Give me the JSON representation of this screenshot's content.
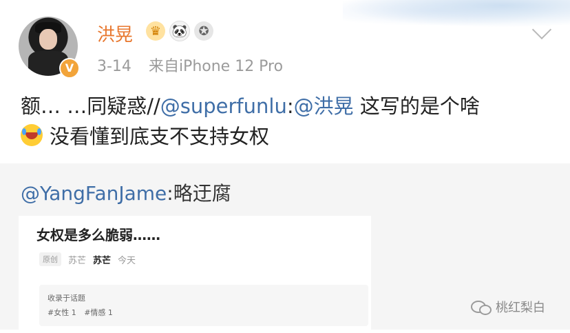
{
  "post": {
    "username": "洪晃",
    "date": "3-14",
    "source": "来自iPhone 12 Pro",
    "text_prefix": "额… …同疑惑//",
    "mention1": "@superfunlu",
    "colon": ":",
    "mention2": "@洪晃",
    "text_line1_end": " 这写的是个啥",
    "text_line2": "没看懂到底支不支持女权",
    "badges": [
      "crown-icon",
      "panda-icon",
      "medal-icon"
    ],
    "verified_badge": "V"
  },
  "repost": {
    "mention": "@YangFanJame",
    "text": ":略迂腐"
  },
  "article_card": {
    "title": "女权是多么脆弱……",
    "tag": "原创",
    "author_a": "苏芒",
    "author_b": "苏芒",
    "time": "今天",
    "topic_title": "收录于话题",
    "topics": [
      "#女性 1",
      "#情感 1"
    ]
  },
  "watermark": {
    "text": "桃红梨白"
  },
  "colors": {
    "username": "#e8772e",
    "mention": "#3f6ea7",
    "meta": "#9b9b9b",
    "repost_bg": "#f5f5f5"
  }
}
